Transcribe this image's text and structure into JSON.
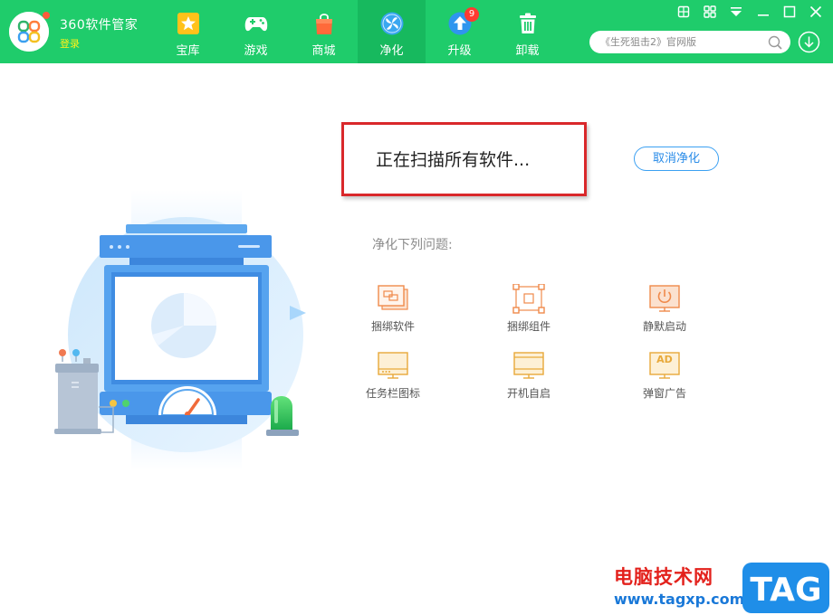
{
  "app": {
    "name": "360软件管家",
    "login_label": "登录"
  },
  "tabs": [
    {
      "label": "宝库",
      "icon": "star-icon"
    },
    {
      "label": "游戏",
      "icon": "gamepad-icon"
    },
    {
      "label": "商城",
      "icon": "shopping-bag-icon"
    },
    {
      "label": "净化",
      "icon": "purify-fan-icon",
      "active": true
    },
    {
      "label": "升级",
      "icon": "upgrade-arrow-icon",
      "badge": "9"
    },
    {
      "label": "卸载",
      "icon": "trash-icon"
    }
  ],
  "window_controls": [
    "skin-icon",
    "app-grid-icon",
    "menu-dropdown-icon",
    "minimize-icon",
    "maximize-icon",
    "close-icon"
  ],
  "search": {
    "placeholder": "《生死狙击2》官网版"
  },
  "status": {
    "scanning_text": "正在扫描所有软件..."
  },
  "cancel_label": "取消净化",
  "issues_heading": "净化下列问题:",
  "issues": [
    {
      "label": "捆绑软件",
      "icon": "bundled-software-icon"
    },
    {
      "label": "捆绑组件",
      "icon": "bundled-component-icon"
    },
    {
      "label": "静默启动",
      "icon": "silent-startup-icon"
    },
    {
      "label": "任务栏图标",
      "icon": "taskbar-icon"
    },
    {
      "label": "开机自启",
      "icon": "boot-autostart-icon"
    },
    {
      "label": "弹窗广告",
      "icon": "popup-ad-icon"
    }
  ],
  "watermark": {
    "title": "电脑技术网",
    "url": "www.tagxp.com",
    "logo_text": "TAG"
  },
  "colors": {
    "header_green": "#1fcc6b",
    "active_tab": "#17b95e",
    "issue_orange": "#f08a4b",
    "issue_gold": "#e8a93a",
    "cancel_blue": "#2a8ce8",
    "highlight_red": "#d9282b"
  }
}
